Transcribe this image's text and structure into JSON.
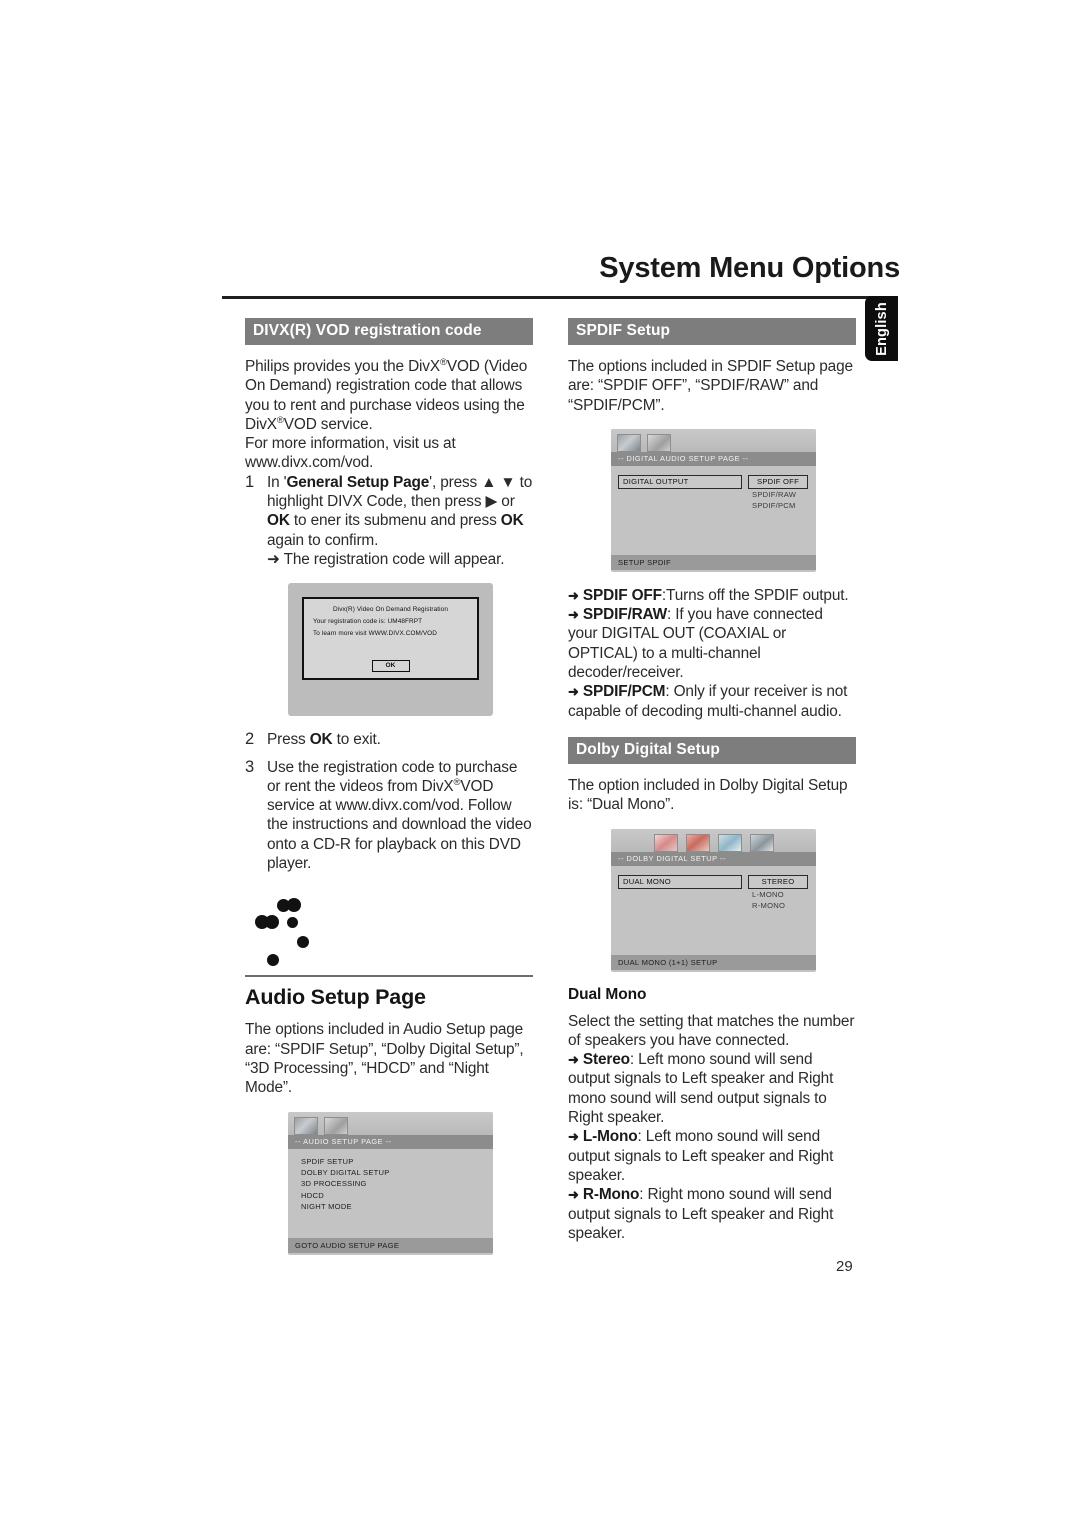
{
  "header": {
    "title": "System Menu Options",
    "language_tab": "English",
    "page_number": "29"
  },
  "left_column": {
    "section1": {
      "heading": "DIVX(R) VOD registration code",
      "intro_p1_a": "Philips provides you the DivX",
      "intro_p1_reg": "®",
      "intro_p1_b": "VOD (Video On Demand) registration code that allows you to rent and purchase videos using the DivX",
      "intro_p1_c": "VOD service.",
      "intro_p2": "For more information, visit us at www.divx.com/vod.",
      "steps": [
        {
          "num": "1",
          "text_a": "In '",
          "bold_a": "General Setup Page",
          "text_b": "', press ▲ ▼ to highlight DIVX Code, then press ▶ or ",
          "bold_b": "OK",
          "text_c": " to ener its submenu and press ",
          "bold_c": "OK",
          "text_d": " again to confirm.",
          "arrow_note": "➜ The registration code will appear."
        },
        {
          "num": "2",
          "text_a": "Press ",
          "bold_a": "OK",
          "text_b": " to exit."
        },
        {
          "num": "3",
          "text_a": "Use the registration code to purchase or rent the videos from DivX",
          "text_b": "VOD service at www.divx.com/vod. Follow the instructions and download the video onto a CD-R for playback on this DVD player."
        }
      ],
      "divx_dialog": {
        "title": "Divx(R) Video On Demand Registration",
        "line1": "Your registration code is: UM48FRPT",
        "line2": "To learn more visit WWW.DIVX.COM/VOD",
        "ok_button": "OK"
      }
    },
    "section2": {
      "title": "Audio Setup Page",
      "intro": "The options included in Audio Setup page are: “SPDIF Setup”, “Dolby Digital Setup”, “3D Processing”, “HDCD” and “Night Mode”.",
      "osd": {
        "title": "-- AUDIO SETUP PAGE --",
        "items": [
          "SPDIF SETUP",
          "DOLBY DIGITAL SETUP",
          "3D PROCESSING",
          "HDCD",
          "NIGHT MODE"
        ],
        "footer": "GOTO AUDIO SETUP PAGE",
        "icons": [
          "video-setup-icon",
          "audio-setup-icon"
        ]
      }
    }
  },
  "right_column": {
    "spdif": {
      "heading": "SPDIF Setup",
      "intro": "The options included in SPDIF Setup page are: “SPDIF OFF”, “SPDIF/RAW” and “SPDIF/PCM”.",
      "osd": {
        "title": "-- DIGITAL AUDIO SETUP PAGE --",
        "row_label": "DIGITAL OUTPUT",
        "selected_option": "SPDIF OFF",
        "options": [
          "SPDIF/RAW",
          "SPDIF/PCM"
        ],
        "footer": "SETUP SPDIF",
        "icons": [
          "video-setup-icon",
          "audio-setup-icon"
        ]
      },
      "bullets": [
        {
          "arrow": "➜",
          "bold": "SPDIF OFF",
          "text": ":Turns off the SPDIF output."
        },
        {
          "arrow": "➜",
          "bold": "SPDIF/RAW",
          "text": ": If you have connected your DIGITAL OUT (COAXIAL or OPTICAL) to a multi-channel decoder/receiver."
        },
        {
          "arrow": "➜",
          "bold": "SPDIF/PCM",
          "text": ": Only if your receiver is not capable of decoding multi-channel audio."
        }
      ]
    },
    "dolby": {
      "heading": "Dolby Digital Setup",
      "intro": "The option included in Dolby Digital Setup is: “Dual Mono”.",
      "osd": {
        "title": "-- DOLBY DIGITAL SETUP --",
        "row_label": "DUAL MONO",
        "selected_option": "STEREO",
        "options": [
          "L-MONO",
          "R-MONO"
        ],
        "footer": "DUAL MONO (1+1) SETUP",
        "icons": [
          "picture-icon-1",
          "picture-icon-2",
          "picture-icon-3",
          "picture-icon-4"
        ]
      },
      "sub_title": "Dual Mono",
      "sub_intro": "Select the setting that matches the number of speakers you have connected.",
      "bullets": [
        {
          "arrow": "➜",
          "bold": "Stereo",
          "text": ": Left mono sound will send output signals to Left speaker and Right mono sound will send output signals to Right speaker."
        },
        {
          "arrow": "➜",
          "bold": "L-Mono",
          "text": ": Left mono sound will send output signals to Left speaker and Right speaker."
        },
        {
          "arrow": "➜",
          "bold": "R-Mono",
          "text": ": Right mono sound will send output signals to Left speaker and Right speaker."
        }
      ]
    }
  },
  "colors": {
    "heading_bar": "#7d7d7d",
    "tab_bg": "#0d0d0d",
    "osd_bg": "#c3c3c3",
    "osd_title_bar": "#8c8c8c"
  }
}
